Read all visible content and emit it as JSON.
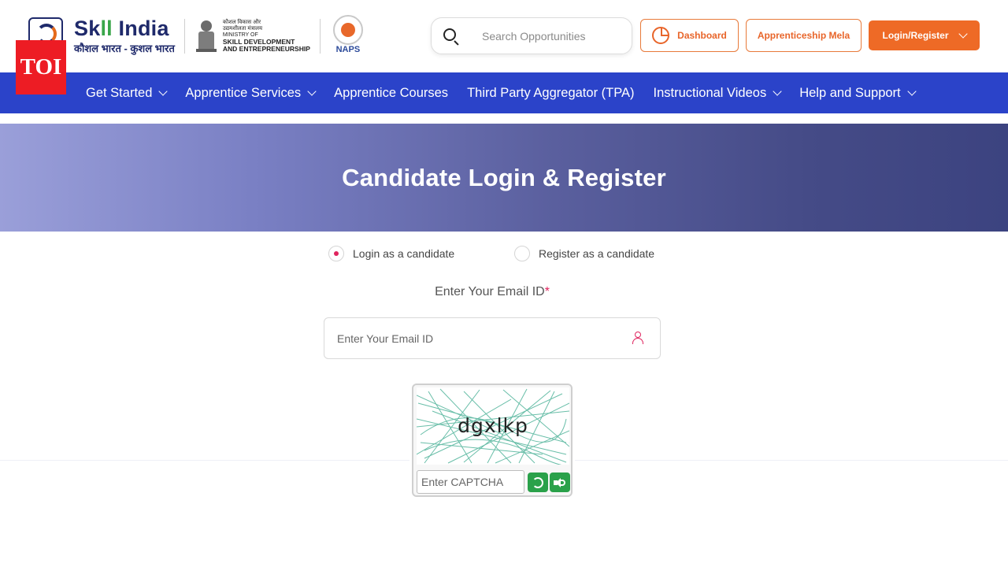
{
  "header": {
    "brand_title_a": "Sk",
    "brand_title_b": "ll",
    "brand_title_c": " India",
    "brand_subtitle": "कौशल भारत - कुशल भारत",
    "ministry_line1": "कौशल विकास और",
    "ministry_line2": "उद्यमशीलता मंत्रालय",
    "ministry_line3": "MINISTRY OF",
    "ministry_line4": "SKILL DEVELOPMENT",
    "ministry_line5": "AND ENTREPRENEURSHIP",
    "naps_label": "NAPS",
    "search_placeholder": "Search Opportunities",
    "dashboard_label": "Dashboard",
    "mela_label": "Apprenticeship Mela",
    "login_label": "Login/Register"
  },
  "watermark": {
    "label": "TOI"
  },
  "nav": {
    "items": [
      {
        "label": "Get Started",
        "dropdown": true
      },
      {
        "label": "Apprentice Services",
        "dropdown": true
      },
      {
        "label": "Apprentice Courses",
        "dropdown": false
      },
      {
        "label": "Third Party Aggregator (TPA)",
        "dropdown": false
      },
      {
        "label": "Instructional Videos",
        "dropdown": true
      },
      {
        "label": "Help and Support",
        "dropdown": true
      }
    ]
  },
  "banner": {
    "title": "Candidate Login & Register"
  },
  "form": {
    "radio_login": "Login as a candidate",
    "radio_register": "Register as a candidate",
    "selected": "login",
    "email_label": "Enter Your Email ID",
    "required_mark": "*",
    "email_placeholder": "Enter Your Email ID",
    "email_value": ""
  },
  "captcha": {
    "text": "dgxlkp",
    "input_placeholder": "Enter CAPTCHA"
  },
  "colors": {
    "nav_bg": "#2b43c9",
    "accent_orange": "#ee6a26",
    "required": "#e0245e",
    "captcha_btn": "#2aa14a",
    "toi_red": "#ed1c24"
  },
  "icons": {
    "search": "search-icon",
    "dashboard": "pie-chart-icon",
    "user": "user-icon",
    "refresh": "refresh-icon",
    "audio": "speaker-icon"
  }
}
